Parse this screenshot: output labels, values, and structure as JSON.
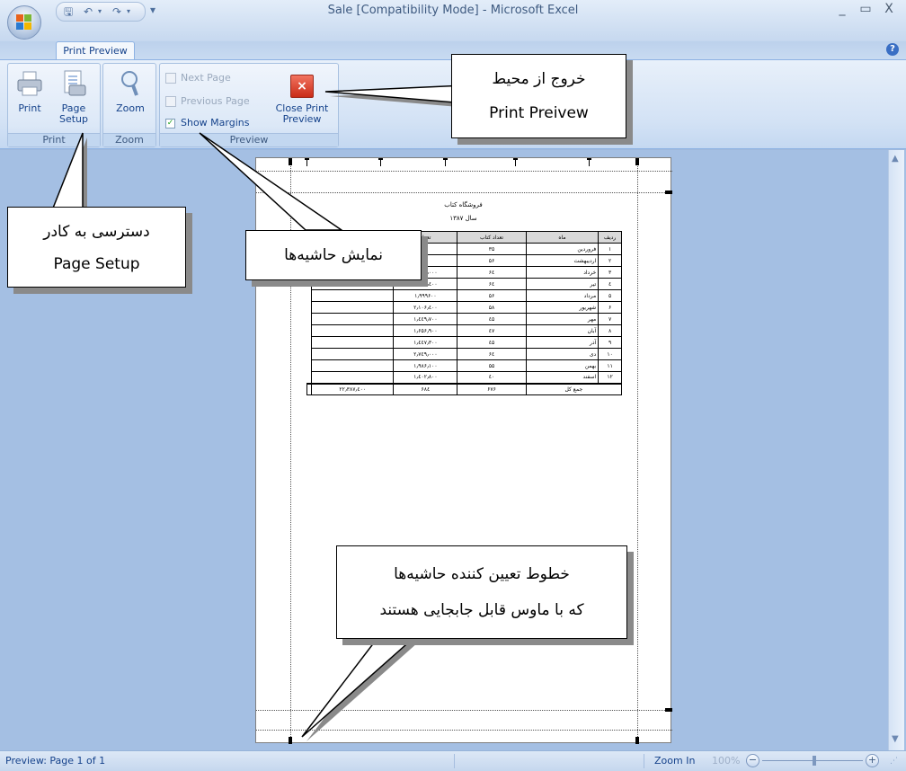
{
  "window": {
    "title": "Sale  [Compatibility Mode] - Microsoft Excel",
    "minimize": "_",
    "restore": "▭",
    "close": "X",
    "help": "?"
  },
  "tabs": [
    {
      "label": "Print Preview"
    }
  ],
  "ribbon": {
    "print_group": {
      "label": "Print",
      "print_button": "Print",
      "page_setup_line1": "Page",
      "page_setup_line2": "Setup"
    },
    "zoom_group": {
      "label": "Zoom",
      "zoom_button": "Zoom"
    },
    "preview_group": {
      "label": "Preview",
      "next_page": "Next Page",
      "previous_page": "Previous Page",
      "show_margins": "Show Margins",
      "show_margins_checked": true,
      "close_line1": "Close Print",
      "close_line2": "Preview"
    }
  },
  "document": {
    "title": "فروشگاه کتاب",
    "subtitle": "سال ۱۳۸۷",
    "columns": [
      "ردیف",
      "ماه",
      "تعداد کتاب",
      "تعداد"
    ],
    "rows": [
      {
        "n": "۱",
        "month": "فروردین",
        "books": "۳۵",
        "amount": ""
      },
      {
        "n": "۲",
        "month": "اردیبهشت",
        "books": "۵۶",
        "amount": ""
      },
      {
        "n": "۳",
        "month": "خرداد",
        "books": "۶٤",
        "amount": "۲٫۰۶۰٫۰۰۰"
      },
      {
        "n": "٤",
        "month": "تیر",
        "books": "۶٤",
        "amount": "۲٫۳۶۹٫٤۰۰"
      },
      {
        "n": "۵",
        "month": "مرداد",
        "books": "۵۶",
        "amount": "۱٫۹۹۹۶۰۰"
      },
      {
        "n": "۶",
        "month": "شهریور",
        "books": "۵۸",
        "amount": "۲٫۱۰۶٫٤۰۰"
      },
      {
        "n": "۷",
        "month": "مهر",
        "books": "٤۵",
        "amount": "۱٫٤٤۹٫۷۰۰"
      },
      {
        "n": "۸",
        "month": "آبان",
        "books": "٤۷",
        "amount": "۱٫۶۵۶٫۹۰۰"
      },
      {
        "n": "۹",
        "month": "آذر",
        "books": "٤۵",
        "amount": "۱٫٤٤۷٫۳۰۰"
      },
      {
        "n": "۱۰",
        "month": "دی",
        "books": "۶٤",
        "amount": "۲٫۷٤۹٫۰۰۰"
      },
      {
        "n": "۱۱",
        "month": "بهمن",
        "books": "۵۵",
        "amount": "۱٫۹۸۶٫۱۰۰"
      },
      {
        "n": "۱۲",
        "month": "اسفند",
        "books": "٤۰",
        "amount": "۱٫٤۰۲٫۸۰۰"
      }
    ],
    "totals": {
      "label": "جمع کل",
      "books": "۶۷۶",
      "col3": "۶۸٤",
      "amount": "۲۲٫۳۸۷٫٤۰۰"
    }
  },
  "callouts": {
    "exit": {
      "line1": "خروج از محیط",
      "line2": "Print Preivew"
    },
    "page_setup": {
      "line1": "دسترسی به کادر",
      "line2": "Page Setup"
    },
    "margins": {
      "line1": "نمایش حاشیه‌ها"
    },
    "lines": {
      "line1": "خطوط تعیین کننده حاشیه‌ها",
      "line2": "که با ماوس قابل جابجایی هستند"
    }
  },
  "statusbar": {
    "left": "Preview: Page 1 of 1",
    "zoom_in": "Zoom In",
    "zoom_pct": "100%",
    "minus": "−",
    "plus": "+"
  }
}
